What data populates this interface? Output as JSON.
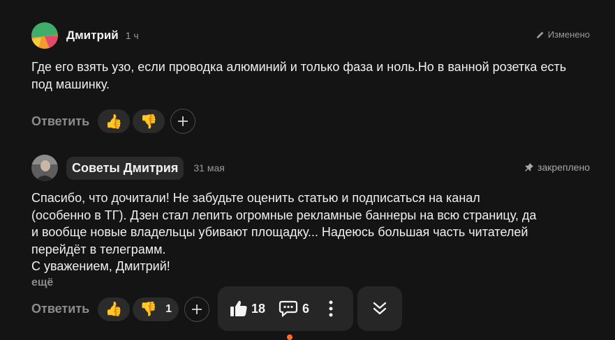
{
  "comments": [
    {
      "author": "Дмитрий",
      "time": "1 ч",
      "status": "Изменено",
      "status_icon": "pencil-icon",
      "text": "Где его взять узо, если проводка алюминий и только фаза и ноль.Но в ванной розетка есть под машинку.",
      "reply_label": "Ответить",
      "like_emoji": "👍",
      "dislike_emoji": "👎"
    },
    {
      "author": "Советы Дмитрия",
      "time": "31 мая",
      "status": "закреплено",
      "status_icon": "pin-icon",
      "text_lines": [
        "Спасибо, что дочитали! Не забудьте оценить статью и подписаться на канал",
        "(особенно в ТГ). Дзен стал лепить огромные рекламные баннеры на всю страницу, да",
        "и вообще новые владельцы убивают площадку... Надеюсь большая часть читателей",
        "перейдёт в телеграмм.",
        "С уважением, Дмитрий!"
      ],
      "more_label": "ещё",
      "reply_label": "Ответить",
      "like_emoji": "👍",
      "dislike_emoji": "👎",
      "dislike_count": "1"
    }
  ],
  "bottom_bar": {
    "likes": "18",
    "comments": "6",
    "notification_color": "#ff6a2a"
  }
}
